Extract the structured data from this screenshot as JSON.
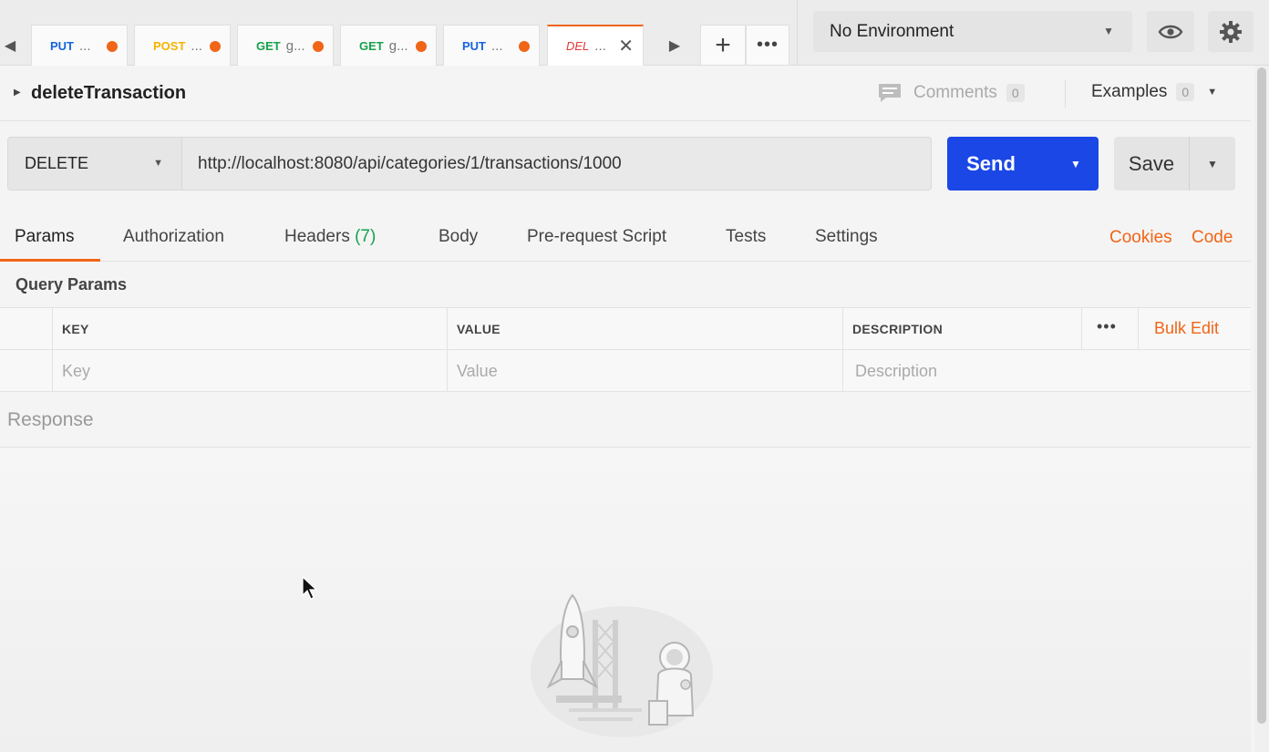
{
  "tabs": [
    {
      "method": "PUT",
      "name": "...",
      "type": "put",
      "unsaved": true
    },
    {
      "method": "POST",
      "name": "...",
      "type": "post",
      "unsaved": true
    },
    {
      "method": "GET",
      "name": "g...",
      "type": "get",
      "unsaved": true
    },
    {
      "method": "GET",
      "name": "g...",
      "type": "get",
      "unsaved": true
    },
    {
      "method": "PUT",
      "name": "...",
      "type": "put",
      "unsaved": true
    },
    {
      "method": "DEL",
      "name": "...",
      "type": "del",
      "active": true
    }
  ],
  "environment": {
    "selected": "No Environment"
  },
  "request": {
    "name": "deleteTransaction",
    "comments_label": "Comments",
    "comments_count": "0",
    "examples_label": "Examples",
    "examples_count": "0",
    "method": "DELETE",
    "url": "http://localhost:8080/api/categories/1/transactions/1000",
    "send_label": "Send",
    "save_label": "Save"
  },
  "subtabs": {
    "params": "Params",
    "authorization": "Authorization",
    "headers": "Headers",
    "headers_count": "(7)",
    "body": "Body",
    "prerequest": "Pre-request Script",
    "tests": "Tests",
    "settings": "Settings",
    "cookies": "Cookies",
    "code": "Code"
  },
  "query_params": {
    "title": "Query Params",
    "columns": {
      "key": "KEY",
      "value": "VALUE",
      "description": "DESCRIPTION"
    },
    "bulk_edit": "Bulk Edit",
    "placeholders": {
      "key": "Key",
      "value": "Value",
      "description": "Description"
    }
  },
  "response": {
    "title": "Response"
  },
  "colors": {
    "accent": "#f06517",
    "send": "#1a47e6",
    "put": "#1565e0",
    "post": "#f5b400",
    "get": "#15a24a",
    "del": "#e53935"
  }
}
